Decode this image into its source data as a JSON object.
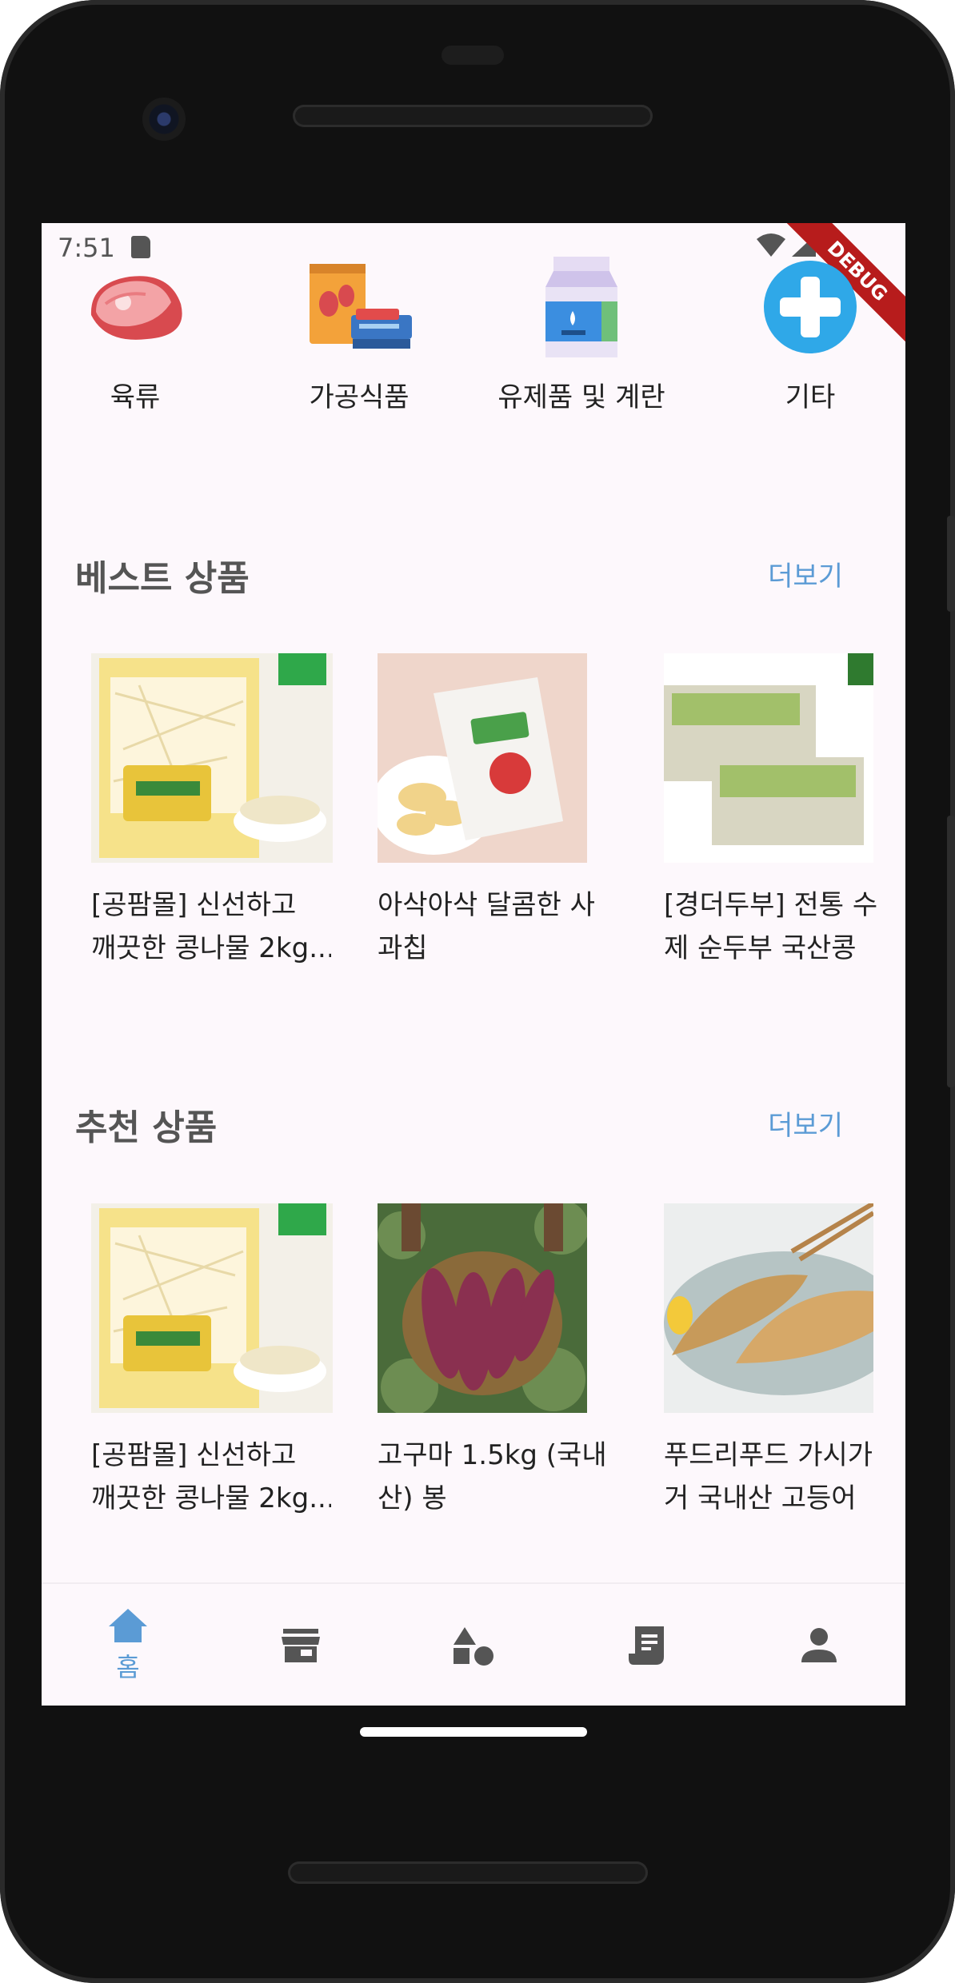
{
  "status_bar": {
    "time": "7:51",
    "debug_label": "DEBUG"
  },
  "categories": [
    {
      "label": "육류",
      "icon": "meat-icon"
    },
    {
      "label": "가공식품",
      "icon": "canned-food-icon"
    },
    {
      "label": "유제품 및 계란",
      "icon": "milk-carton-icon"
    },
    {
      "label": "기타",
      "icon": "plus-circle-icon"
    }
  ],
  "best": {
    "title": "베스트 상품",
    "more": "더보기",
    "items": [
      {
        "line1": "[공팜몰] 신선하고",
        "line2": "깨끗한 콩나물 2kg...",
        "image": "bean-sprouts-photo"
      },
      {
        "line1": "아삭아삭 달콤한 사",
        "line2": "과칩",
        "image": "apple-chips-photo"
      },
      {
        "line1": "[경더두부] 전통 수",
        "line2": "제 순두부 국산콩",
        "image": "tofu-photo"
      }
    ]
  },
  "recommended": {
    "title": "추천 상품",
    "more": "더보기",
    "items": [
      {
        "line1": "[공팜몰] 신선하고",
        "line2": "깨끗한 콩나물 2kg...",
        "image": "bean-sprouts-photo"
      },
      {
        "line1": "고구마 1.5kg (국내",
        "line2": "산) 봉",
        "image": "sweet-potato-photo"
      },
      {
        "line1": "푸드리푸드 가시가",
        "line2": "거 국내산 고등어",
        "image": "mackerel-photo"
      }
    ]
  },
  "bottom_nav": [
    {
      "label": "홈",
      "icon": "home-icon",
      "active": true
    },
    {
      "label": "",
      "icon": "store-icon",
      "active": false
    },
    {
      "label": "",
      "icon": "categories-shapes-icon",
      "active": false
    },
    {
      "label": "",
      "icon": "receipt-icon",
      "active": false
    },
    {
      "label": "",
      "icon": "person-icon",
      "active": false
    }
  ],
  "colors": {
    "accent": "#5b9bd5",
    "background": "#fdf8fc",
    "nav_inactive": "#555555"
  }
}
